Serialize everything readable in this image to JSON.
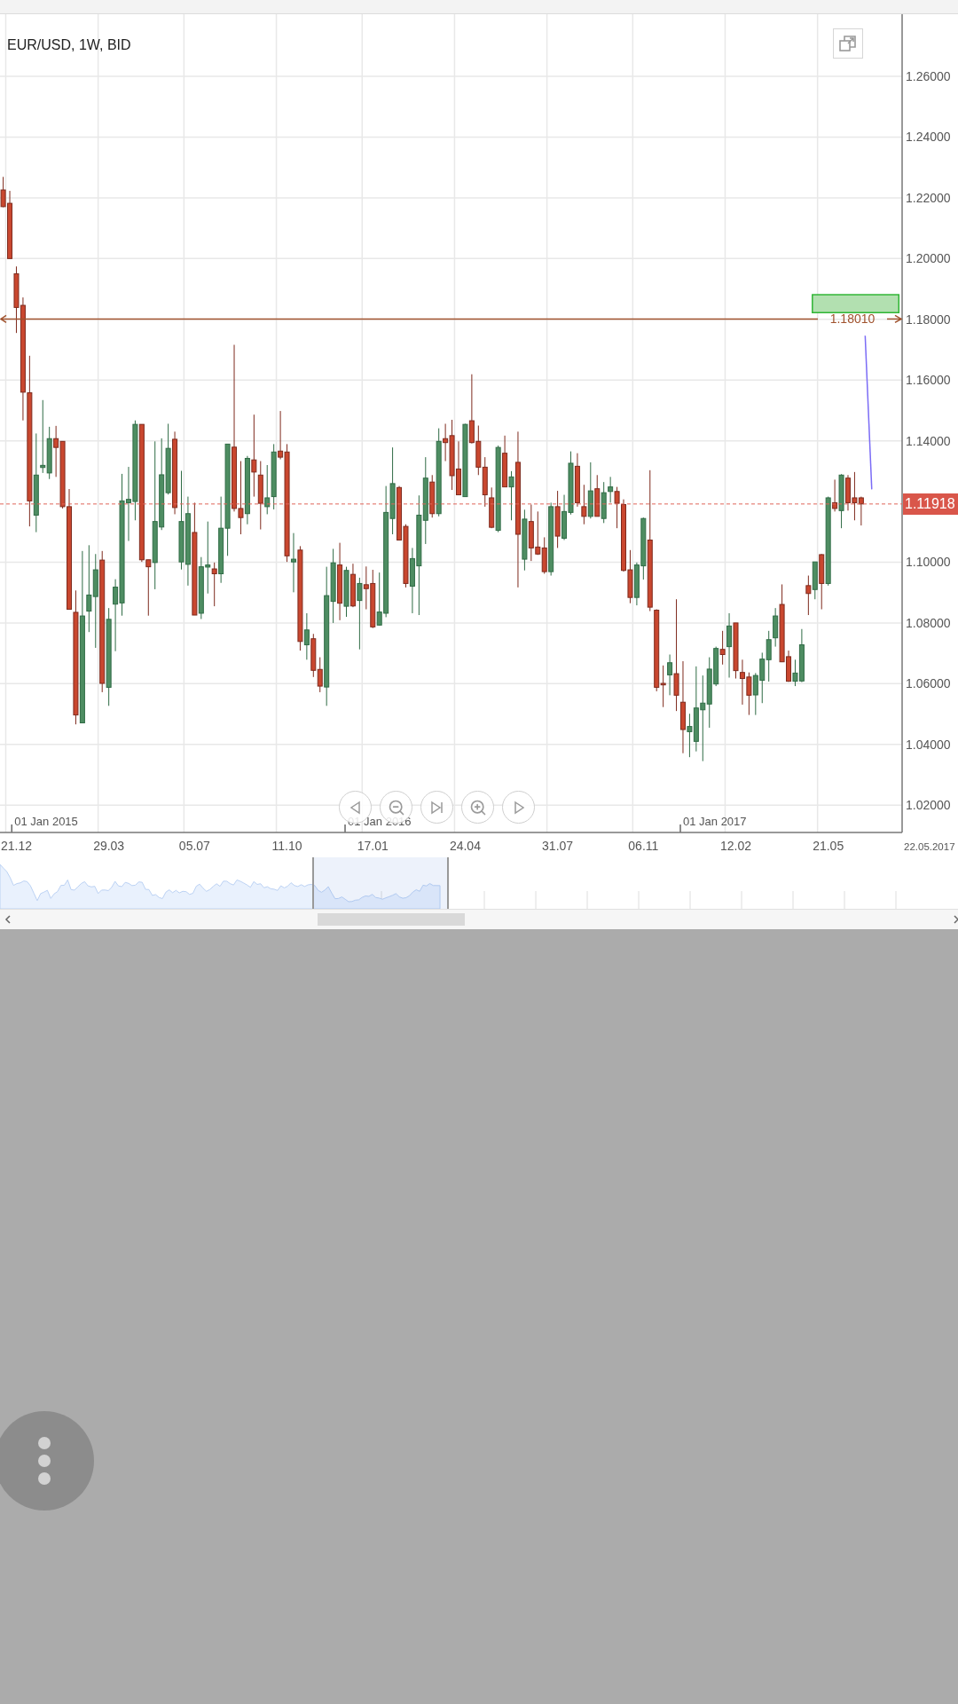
{
  "chart": {
    "chart_data": {
      "type": "candlestick",
      "title": "EUR/USD, 1W, BID",
      "ylim": [
        1.011,
        1.2796
      ],
      "grid": true,
      "categories": [
        null,
        null,
        "21.12",
        null,
        null,
        null,
        null,
        null,
        null,
        null,
        null,
        null,
        null,
        null,
        null,
        null,
        "29.03",
        null,
        null,
        null,
        null,
        null,
        null,
        null,
        null,
        null,
        null,
        null,
        null,
        "05.07",
        null,
        null,
        null,
        null,
        null,
        null,
        null,
        null,
        null,
        null,
        null,
        null,
        null,
        "11.10",
        null,
        null,
        null,
        null,
        null,
        null,
        null,
        null,
        null,
        null,
        null,
        null,
        "17.01",
        null,
        null,
        null,
        null,
        null,
        null,
        null,
        null,
        null,
        null,
        null,
        null,
        null,
        "24.04",
        null,
        null,
        null,
        null,
        null,
        null,
        null,
        null,
        null,
        null,
        null,
        null,
        null,
        "31.07",
        null,
        null,
        null,
        null,
        null,
        null,
        null,
        null,
        null,
        null,
        null,
        null,
        "06.11",
        null,
        null,
        null,
        null,
        null,
        null,
        null,
        null,
        null,
        null,
        null,
        null,
        null,
        "12.02",
        null,
        null,
        null,
        null,
        null,
        null,
        null,
        null,
        null,
        null,
        null,
        null,
        null,
        "21.05",
        null,
        null,
        null,
        null,
        null
      ],
      "yticks": [
        {
          "value": 1.02,
          "label": "1.02000"
        },
        {
          "value": 1.04,
          "label": "1.04000"
        },
        {
          "value": 1.06,
          "label": "1.06000"
        },
        {
          "value": 1.08,
          "label": "1.08000"
        },
        {
          "value": 1.1,
          "label": "1.10000"
        },
        {
          "value": 1.14,
          "label": "1.14000"
        },
        {
          "value": 1.16,
          "label": "1.16000"
        },
        {
          "value": 1.18,
          "label": "1.18000"
        },
        {
          "value": 1.2,
          "label": "1.20000"
        },
        {
          "value": 1.22,
          "label": "1.22000"
        },
        {
          "value": 1.24,
          "label": "1.24000"
        },
        {
          "value": 1.26,
          "label": "1.26000"
        }
      ],
      "ohlc": [
        [
          1.2226,
          1.2269,
          1.2169,
          1.2171
        ],
        [
          1.2182,
          1.2223,
          1.2,
          1.2
        ],
        [
          1.195,
          1.1974,
          1.1755,
          1.1839
        ],
        [
          1.1846,
          1.1872,
          1.1467,
          1.156
        ],
        [
          1.1558,
          1.168,
          1.1118,
          1.1202
        ],
        [
          1.1155,
          1.1424,
          1.1099,
          1.1287
        ],
        [
          1.1312,
          1.1534,
          1.1294,
          1.1319
        ],
        [
          1.1294,
          1.1446,
          1.1274,
          1.1407
        ],
        [
          1.1407,
          1.1449,
          1.1281,
          1.1378
        ],
        [
          1.1398,
          1.1398,
          1.1177,
          1.1183
        ],
        [
          1.1183,
          1.1241,
          1.0845,
          1.0845
        ],
        [
          1.0835,
          1.0907,
          1.0466,
          1.0497
        ],
        [
          1.0471,
          1.1037,
          1.0471,
          1.0823
        ],
        [
          1.0839,
          1.1056,
          1.077,
          1.0892
        ],
        [
          1.0887,
          1.1027,
          1.0718,
          1.0975
        ],
        [
          1.1007,
          1.1037,
          1.0572,
          1.0601
        ],
        [
          1.0588,
          1.0849,
          1.0527,
          1.0812
        ],
        [
          1.0862,
          1.0944,
          1.0707,
          1.0918
        ],
        [
          1.0866,
          1.1291,
          1.0824,
          1.1202
        ],
        [
          1.1196,
          1.1314,
          1.107,
          1.1207
        ],
        [
          1.12,
          1.1467,
          1.1138,
          1.1454
        ],
        [
          1.1454,
          1.1454,
          1.1001,
          1.1008
        ],
        [
          1.1008,
          1.1008,
          1.0824,
          1.0985
        ],
        [
          1.0999,
          1.1398,
          1.0911,
          1.1134
        ],
        [
          1.1116,
          1.1408,
          1.1106,
          1.1288
        ],
        [
          1.1229,
          1.1456,
          1.1223,
          1.1375
        ],
        [
          1.1405,
          1.143,
          1.1158,
          1.118
        ],
        [
          1.1001,
          1.1301,
          1.0976,
          1.1134
        ],
        [
          1.0993,
          1.1216,
          1.0923,
          1.116
        ],
        [
          1.1098,
          1.1196,
          1.0826,
          1.0826
        ],
        [
          1.0832,
          1.1017,
          1.0813,
          1.0985
        ],
        [
          1.0984,
          1.1134,
          1.0897,
          1.0991
        ],
        [
          1.0978,
          1.0999,
          1.0855,
          1.0962
        ],
        [
          1.0962,
          1.1216,
          1.0932,
          1.1112
        ],
        [
          1.1112,
          1.1389,
          1.1021,
          1.1389
        ],
        [
          1.1379,
          1.1716,
          1.1167,
          1.1177
        ],
        [
          1.1177,
          1.1333,
          1.1092,
          1.1147
        ],
        [
          1.116,
          1.135,
          1.1125,
          1.1342
        ],
        [
          1.1337,
          1.1486,
          1.1216,
          1.1297
        ],
        [
          1.1287,
          1.1333,
          1.1108,
          1.1194
        ],
        [
          1.1183,
          1.132,
          1.1158,
          1.1212
        ],
        [
          1.1216,
          1.1389,
          1.1174,
          1.1363
        ],
        [
          1.1366,
          1.1498,
          1.1339,
          1.1346
        ],
        [
          1.1363,
          1.1389,
          1.1001,
          1.1021
        ],
        [
          1.1001,
          1.1096,
          1.0901,
          1.101
        ],
        [
          1.104,
          1.1053,
          1.0709,
          1.0739
        ],
        [
          1.0728,
          1.0832,
          1.0679,
          1.0777
        ],
        [
          1.0748,
          1.0764,
          1.0622,
          1.0644
        ],
        [
          1.0647,
          1.0687,
          1.0572,
          1.0592
        ],
        [
          1.0589,
          1.0985,
          1.0527,
          1.089
        ],
        [
          1.0871,
          1.1044,
          1.08,
          1.0998
        ],
        [
          1.0991,
          1.1064,
          1.0809,
          1.0865
        ],
        [
          1.0855,
          1.0985,
          1.082,
          1.0973
        ],
        [
          1.096,
          1.0995,
          1.0852,
          1.0856
        ],
        [
          1.0874,
          1.0949,
          1.0713,
          1.093
        ],
        [
          1.0926,
          1.0986,
          1.0845,
          1.0913
        ],
        [
          1.093,
          1.0975,
          1.0783,
          1.0787
        ],
        [
          1.0793,
          1.0966,
          1.0791,
          1.0836
        ],
        [
          1.0832,
          1.1251,
          1.0819,
          1.1164
        ],
        [
          1.1144,
          1.1378,
          1.1092,
          1.1259
        ],
        [
          1.1246,
          1.1251,
          1.1073,
          1.1073
        ],
        [
          1.1118,
          1.1125,
          1.0917,
          1.093
        ],
        [
          1.0921,
          1.1047,
          1.0832,
          1.1012
        ],
        [
          1.0988,
          1.122,
          1.0826,
          1.1155
        ],
        [
          1.1138,
          1.1346,
          1.106,
          1.1277
        ],
        [
          1.1264,
          1.1287,
          1.1147,
          1.116
        ],
        [
          1.116,
          1.1441,
          1.1151,
          1.1398
        ],
        [
          1.1407,
          1.1456,
          1.1333,
          1.1394
        ],
        [
          1.1417,
          1.1469,
          1.1238,
          1.1285
        ],
        [
          1.1307,
          1.1398,
          1.1222,
          1.1222
        ],
        [
          1.1216,
          1.1456,
          1.1216,
          1.1454
        ],
        [
          1.1466,
          1.1619,
          1.1391,
          1.1394
        ],
        [
          1.1398,
          1.145,
          1.1287,
          1.1313
        ],
        [
          1.1313,
          1.1346,
          1.1183,
          1.1222
        ],
        [
          1.1212,
          1.1246,
          1.1112,
          1.1115
        ],
        [
          1.1105,
          1.1384,
          1.1099,
          1.1378
        ],
        [
          1.1359,
          1.1417,
          1.1248,
          1.1248
        ],
        [
          1.1248,
          1.13,
          1.1138,
          1.1281
        ],
        [
          1.1329,
          1.143,
          1.0917,
          1.1092
        ],
        [
          1.101,
          1.1173,
          1.0973,
          1.1142
        ],
        [
          1.1134,
          1.119,
          1.1004,
          1.1047
        ],
        [
          1.105,
          1.1167,
          1.1024,
          1.1027
        ],
        [
          1.1047,
          1.1082,
          1.0962,
          1.0969
        ],
        [
          1.0969,
          1.1196,
          1.0956,
          1.1183
        ],
        [
          1.1183,
          1.1235,
          1.1047,
          1.1086
        ],
        [
          1.1079,
          1.1222,
          1.1073,
          1.1167
        ],
        [
          1.1164,
          1.1365,
          1.1157,
          1.1326
        ],
        [
          1.1316,
          1.1359,
          1.1183,
          1.1196
        ],
        [
          1.1183,
          1.1255,
          1.1125,
          1.1151
        ],
        [
          1.1151,
          1.1329,
          1.1144,
          1.1235
        ],
        [
          1.1242,
          1.1287,
          1.1151,
          1.1151
        ],
        [
          1.1144,
          1.1264,
          1.1129,
          1.1229
        ],
        [
          1.1233,
          1.1281,
          1.1196,
          1.1248
        ],
        [
          1.1233,
          1.1248,
          1.1112,
          1.1194
        ],
        [
          1.119,
          1.1207,
          1.0969,
          1.0973
        ],
        [
          1.0975,
          1.104,
          1.0865,
          1.0884
        ],
        [
          1.0884,
          1.0999,
          1.0858,
          1.0991
        ],
        [
          1.0988,
          1.1147,
          1.0943,
          1.1144
        ],
        [
          1.1073,
          1.1303,
          1.0839,
          1.0852
        ],
        [
          1.0842,
          1.0845,
          1.0575,
          1.0588
        ],
        [
          1.0601,
          1.066,
          1.0523,
          1.0596
        ],
        [
          1.0629,
          1.0696,
          1.0562,
          1.0669
        ],
        [
          1.0633,
          1.0878,
          1.051,
          1.0562
        ],
        [
          1.0539,
          1.0674,
          1.0371,
          1.0449
        ],
        [
          1.0442,
          1.0501,
          1.0358,
          1.0459
        ],
        [
          1.041,
          1.0657,
          1.0377,
          1.052
        ],
        [
          1.0514,
          1.0627,
          1.0345,
          1.0536
        ],
        [
          1.0533,
          1.0687,
          1.0455,
          1.0648
        ],
        [
          1.0599,
          1.0722,
          1.0592,
          1.0716
        ],
        [
          1.0713,
          1.0774,
          1.0663,
          1.0696
        ],
        [
          1.0722,
          1.0832,
          1.062,
          1.079
        ],
        [
          1.08,
          1.08,
          1.0617,
          1.0643
        ],
        [
          1.0637,
          1.0679,
          1.0531,
          1.0617
        ],
        [
          1.0622,
          1.0637,
          1.0497,
          1.0562
        ],
        [
          1.0563,
          1.0635,
          1.0497,
          1.0627
        ],
        [
          1.0611,
          1.0702,
          1.0536,
          1.0681
        ],
        [
          1.0679,
          1.0774,
          1.0607,
          1.0745
        ],
        [
          1.0751,
          1.0849,
          1.0722,
          1.0823
        ],
        [
          1.0861,
          1.0927,
          1.0671,
          1.0672
        ],
        [
          1.0689,
          1.0709,
          1.0606,
          1.0608
        ],
        [
          1.0608,
          1.0679,
          1.0592,
          1.0635
        ],
        [
          1.0609,
          1.078,
          1.0605,
          1.0728
        ],
        [
          1.0923,
          1.0956,
          1.0826,
          1.0897
        ],
        [
          1.091,
          1.1001,
          1.0878,
          1.1001
        ],
        [
          1.1025,
          1.1027,
          1.0845,
          1.093
        ],
        [
          1.093,
          1.1216,
          1.0923,
          1.1212
        ],
        [
          1.1196,
          1.1272,
          1.1167,
          1.1177
        ],
        [
          1.117,
          1.129,
          1.1112,
          1.1287
        ],
        [
          1.1277,
          1.1287,
          1.117,
          1.1196
        ],
        [
          1.1212,
          1.1297,
          1.1138,
          1.1196
        ],
        [
          1.1212,
          1.1216,
          1.1121,
          1.1192
        ]
      ]
    },
    "price_line_label": "1.18010",
    "current_price": "1.11918",
    "year_labels": [
      "01 Jan 2015",
      "01 Jan 2016",
      "01 Jan 2017"
    ],
    "last_date": "22.05.2017"
  }
}
